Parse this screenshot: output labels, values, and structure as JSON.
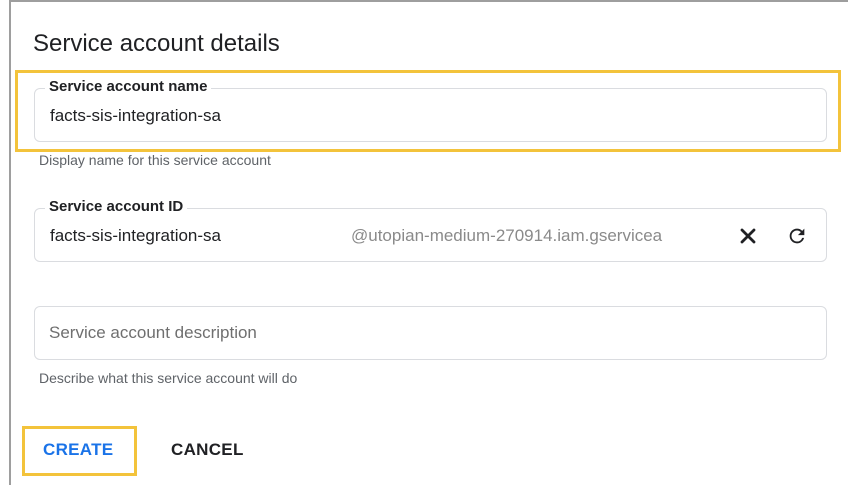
{
  "dialog": {
    "title": "Service account details"
  },
  "name_field": {
    "label": "Service account name",
    "value": "facts-sis-integration-sa",
    "helper": "Display name for this service account"
  },
  "id_field": {
    "label": "Service account ID",
    "value": "facts-sis-integration-sa",
    "suffix": "@utopian-medium-270914.iam.gservicea"
  },
  "description_field": {
    "placeholder": "Service account description",
    "helper": "Describe what this service account will do"
  },
  "actions": {
    "create_label": "CREATE",
    "cancel_label": "CANCEL"
  },
  "icons": {
    "clear": "close-icon",
    "refresh": "refresh-icon"
  },
  "colors": {
    "highlight": "#f3c33b",
    "primary": "#1a73e8",
    "text": "#202124"
  }
}
